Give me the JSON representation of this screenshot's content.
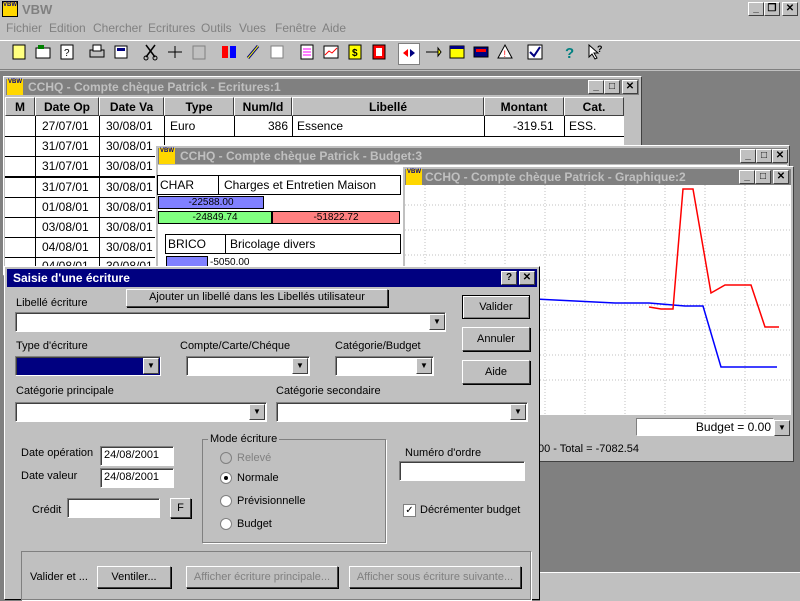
{
  "app": {
    "title": "VBW"
  },
  "menu": [
    "Fichier",
    "Edition",
    "Chercher",
    "Ecritures",
    "Outils",
    "Vues",
    "Fenêtre",
    "Aide"
  ],
  "toolbar": [
    "new-document-icon",
    "open-icon",
    "help-doc-icon",
    "print-icon",
    "calculator-icon",
    "cut-icon",
    "split-icon",
    "paste-icon",
    "category-icon",
    "edit-pencil-icon",
    "notes-icon",
    "report-icon",
    "chart-icon",
    "dollar-icon",
    "bill-icon",
    "reconcile-icon",
    "transfer-icon",
    "calendar-icon",
    "card-icon",
    "warning-icon",
    "checkmark-icon",
    "help-icon",
    "context-help-icon"
  ],
  "ecritures": {
    "title": "CCHQ - Compte chèque Patrick - Ecritures:1",
    "headers": [
      "M",
      "Date Op",
      "Date Va",
      "Type",
      "Num/Id",
      "Libellé",
      "Montant",
      "Cat."
    ],
    "rows": [
      [
        "",
        "27/07/01",
        "30/08/01",
        "Euro",
        "386",
        "Essence",
        "-319.51",
        "ESS."
      ],
      [
        "",
        "31/07/01",
        "30/08/01",
        "",
        "",
        "",
        "",
        ""
      ],
      [
        "",
        "31/07/01",
        "30/08/01",
        "",
        "",
        "",
        "",
        ""
      ],
      [
        "",
        "31/07/01",
        "30/08/01",
        "",
        "",
        "",
        "",
        ""
      ],
      [
        "",
        "01/08/01",
        "30/08/01",
        "",
        "",
        "",
        "",
        ""
      ],
      [
        "",
        "03/08/01",
        "30/08/01",
        "",
        "",
        "",
        "",
        ""
      ],
      [
        "",
        "04/08/01",
        "30/08/01",
        "",
        "",
        "",
        "",
        ""
      ],
      [
        "",
        "04/08/01",
        "30/08/01",
        "",
        "",
        "",
        "",
        ""
      ]
    ]
  },
  "budget": {
    "title": "CCHQ - Compte chèque Patrick - Budget:3",
    "cat1_code": "CHAR",
    "cat1_name": "Charges et Entretien Maison",
    "cat1_bar1": "-22588.00",
    "cat1_bar2": "-24849.74",
    "cat1_bar3": "-51822.72",
    "cat2_code": "BRICO",
    "cat2_name": "Bricolage divers",
    "cat2_bar1": "-5050.00"
  },
  "graphique": {
    "title": "CCHQ - Compte chèque Patrick - Graphique:2",
    "budget_label": "Budget = 0.00",
    "status": "00 - Total = -7082.54",
    "colors": {
      "blue": "#0000ff",
      "red": "#ff0000"
    }
  },
  "dialog": {
    "title": "Saisie d'une écriture",
    "libelle_label": "Libellé écriture",
    "add_libelle_button": "Ajouter un libellé dans les Libellés utilisateur",
    "type_label": "Type d'écriture",
    "compte_label": "Compte/Carte/Chéque",
    "categorie_budget_label": "Catégorie/Budget",
    "cat_principale_label": "Catégorie principale",
    "cat_secondaire_label": "Catégorie secondaire",
    "date_operation_label": "Date opération",
    "date_operation_value": "24/08/2001",
    "date_valeur_label": "Date valeur",
    "date_valeur_value": "24/08/2001",
    "credit_label": "Crédit",
    "credit_f_button": "F",
    "mode_label": "Mode écriture",
    "mode_options": [
      "Relevé",
      "Normale",
      "Prévisionnelle",
      "Budget"
    ],
    "mode_selected": "Normale",
    "numero_label": "Numéro d'ordre",
    "decrementer_label": "Décrémenter budget",
    "decrementer_checked": true,
    "valider_button": "Valider",
    "annuler_button": "Annuler",
    "aide_button": "Aide",
    "valider_et_label": "Valider et ...",
    "ventiler_button": "Ventiler...",
    "afficher_principale_button": "Afficher écriture principale...",
    "afficher_suivante_button": "Afficher sous écriture suivante..."
  }
}
